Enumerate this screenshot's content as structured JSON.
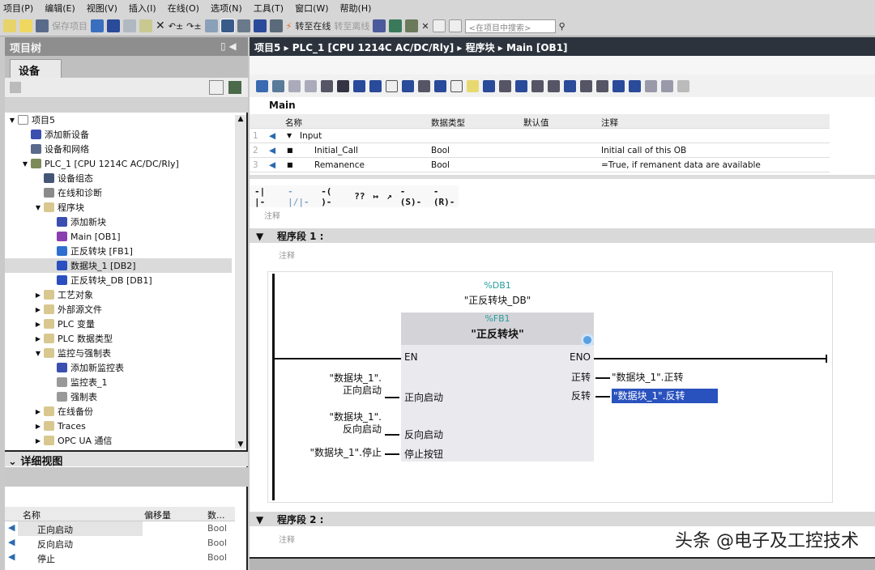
{
  "menu": [
    "项目(P)",
    "编辑(E)",
    "视图(V)",
    "插入(I)",
    "在线(O)",
    "选项(N)",
    "工具(T)",
    "窗口(W)",
    "帮助(H)"
  ],
  "toolbar": {
    "save_project": "保存项目",
    "go_online": "转至在线",
    "go_offline": "转至离线",
    "search_placeholder": "<在项目中搜索>"
  },
  "project_tree": {
    "title": "项目树",
    "tab": "设备",
    "items": [
      {
        "label": "项目5",
        "level": 0,
        "exp": "▼",
        "color": "#ffffff"
      },
      {
        "label": "添加新设备",
        "level": 1,
        "exp": "",
        "color": "#3a4fb0"
      },
      {
        "label": "设备和网络",
        "level": 1,
        "exp": "",
        "color": "#5a6a8a"
      },
      {
        "label": "PLC_1 [CPU 1214C AC/DC/Rly]",
        "level": 1,
        "exp": "▼",
        "color": "#7c8a5a"
      },
      {
        "label": "设备组态",
        "level": 2,
        "exp": "",
        "color": "#445577"
      },
      {
        "label": "在线和诊断",
        "level": 2,
        "exp": "",
        "color": "#8a8a8a"
      },
      {
        "label": "程序块",
        "level": 2,
        "exp": "▼",
        "color": "#d8c890"
      },
      {
        "label": "添加新块",
        "level": 3,
        "exp": "",
        "color": "#3a4fb0"
      },
      {
        "label": "Main [OB1]",
        "level": 3,
        "exp": "",
        "color": "#8a3fb0"
      },
      {
        "label": "正反转块 [FB1]",
        "level": 3,
        "exp": "",
        "color": "#2f6fd0"
      },
      {
        "label": "数据块_1 [DB2]",
        "level": 3,
        "exp": "",
        "color": "#2b4fc0",
        "selected": true
      },
      {
        "label": "正反转块_DB [DB1]",
        "level": 3,
        "exp": "",
        "color": "#2b4fc0"
      },
      {
        "label": "工艺对象",
        "level": 2,
        "exp": "▶",
        "color": "#d8c890"
      },
      {
        "label": "外部源文件",
        "level": 2,
        "exp": "▶",
        "color": "#d8c890"
      },
      {
        "label": "PLC 变量",
        "level": 2,
        "exp": "▶",
        "color": "#d8c890"
      },
      {
        "label": "PLC 数据类型",
        "level": 2,
        "exp": "▶",
        "color": "#d8c890"
      },
      {
        "label": "监控与强制表",
        "level": 2,
        "exp": "▼",
        "color": "#d8c890"
      },
      {
        "label": "添加新监控表",
        "level": 3,
        "exp": "",
        "color": "#3a4fb0"
      },
      {
        "label": "监控表_1",
        "level": 3,
        "exp": "",
        "color": "#999999"
      },
      {
        "label": "强制表",
        "level": 3,
        "exp": "",
        "color": "#999999"
      },
      {
        "label": "在线备份",
        "level": 2,
        "exp": "▶",
        "color": "#d8c890"
      },
      {
        "label": "Traces",
        "level": 2,
        "exp": "▶",
        "color": "#d8c890"
      },
      {
        "label": "OPC UA 通信",
        "level": 2,
        "exp": "▶",
        "color": "#d8c890"
      }
    ]
  },
  "detail_view": {
    "title": "详细视图",
    "columns": [
      "名称",
      "偏移量",
      "数..."
    ],
    "rows": [
      {
        "name": "正向启动",
        "type": "Bool"
      },
      {
        "name": "反向启动",
        "type": "Bool"
      },
      {
        "name": "停止",
        "type": "Bool"
      }
    ]
  },
  "breadcrumb": [
    "项目5",
    "PLC_1 [CPU 1214C AC/DC/Rly]",
    "程序块",
    "Main [OB1]"
  ],
  "block_name": "Main",
  "interface": {
    "columns": [
      "名称",
      "数据类型",
      "默认值",
      "注释"
    ],
    "rows": [
      {
        "no": "1",
        "name": "Input",
        "type": "",
        "default": "",
        "comment": ""
      },
      {
        "no": "2",
        "name": "Initial_Call",
        "type": "Bool",
        "default": "",
        "comment": "Initial call of this OB"
      },
      {
        "no": "3",
        "name": "Remanence",
        "type": "Bool",
        "default": "",
        "comment": "=True, if remanent data are available"
      }
    ]
  },
  "instructions": [
    "-| |-",
    "-|/|-",
    "-( )-",
    "??",
    "↦",
    "↗",
    "-(S)-",
    "-(R)-"
  ],
  "block_comment": "注释",
  "network1": {
    "title": "程序段 1 :",
    "comment": "注释",
    "instance_addr": "%DB1",
    "instance_name": "\"正反转块_DB\"",
    "fb_addr": "%FB1",
    "fb_name": "\"正反转块\"",
    "en": "EN",
    "eno": "ENO",
    "inputs": [
      {
        "pin": "正向启动",
        "operand": [
          "\"数据块_1\".",
          "正向启动"
        ]
      },
      {
        "pin": "反向启动",
        "operand": [
          "\"数据块_1\".",
          "反向启动"
        ]
      },
      {
        "pin": "停止按钮",
        "operand": [
          "\"数据块_1\".停止"
        ]
      }
    ],
    "outputs": [
      {
        "pin": "正转",
        "operand": "\"数据块_1\".正转"
      },
      {
        "pin": "反转",
        "operand": "\"数据块_1\".反转"
      }
    ]
  },
  "network2": {
    "title": "程序段 2 :",
    "comment": "注释"
  },
  "watermark": "头条 @电子及工控技术",
  "colors": {
    "accent": "#2c333d",
    "selection": "#2a52be",
    "address": "#2a9d9d"
  }
}
